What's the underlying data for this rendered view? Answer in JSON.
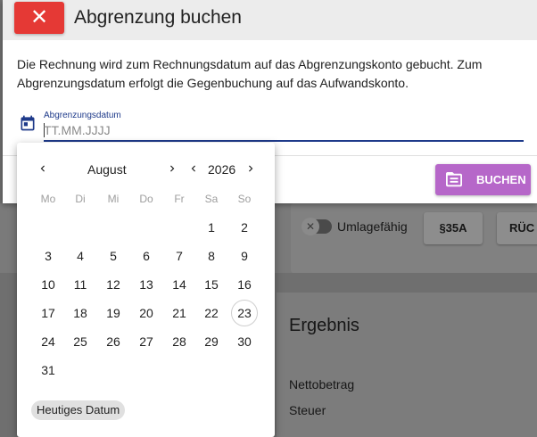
{
  "dialog": {
    "title": "Abgrenzung buchen",
    "close_icon": "close-icon",
    "description": "Die Rechnung wird zum Rechnungsdatum auf das Abgrenzungskonto gebucht. Zum Abgrenzungsdatum erfolgt die Gegenbuchung auf das Aufwandskonto.",
    "date_field": {
      "label": "Abgrenzungsdatum",
      "placeholder": "TT.MM.JJJJ",
      "value": "",
      "icon": "calendar-icon"
    },
    "book_button": {
      "label": "BUCHEN",
      "icon": "document-icon"
    }
  },
  "calendar": {
    "month": "August",
    "year": "2026",
    "weekdays": [
      "Mo",
      "Di",
      "Mi",
      "Do",
      "Fr",
      "Sa",
      "So"
    ],
    "days": [
      "1",
      "2",
      "3",
      "4",
      "5",
      "6",
      "7",
      "8",
      "9",
      "10",
      "11",
      "12",
      "13",
      "14",
      "15",
      "16",
      "17",
      "18",
      "19",
      "20",
      "21",
      "22",
      "23",
      "24",
      "25",
      "26",
      "27",
      "28",
      "29",
      "30",
      "31"
    ],
    "first_weekday_index": 5,
    "highlighted_day": "23",
    "today_button": "Heutiges Datum"
  },
  "background": {
    "toggle_label": "Umlagefähig",
    "btn_35a": "§35A",
    "btn_rueck": "RÜC",
    "section_title": "Ergebnis",
    "rows": [
      "Nettobetrag",
      "Steuer"
    ]
  },
  "colors": {
    "close": "#e53935",
    "book": "#b667c9",
    "accent": "#1e3a8a"
  }
}
